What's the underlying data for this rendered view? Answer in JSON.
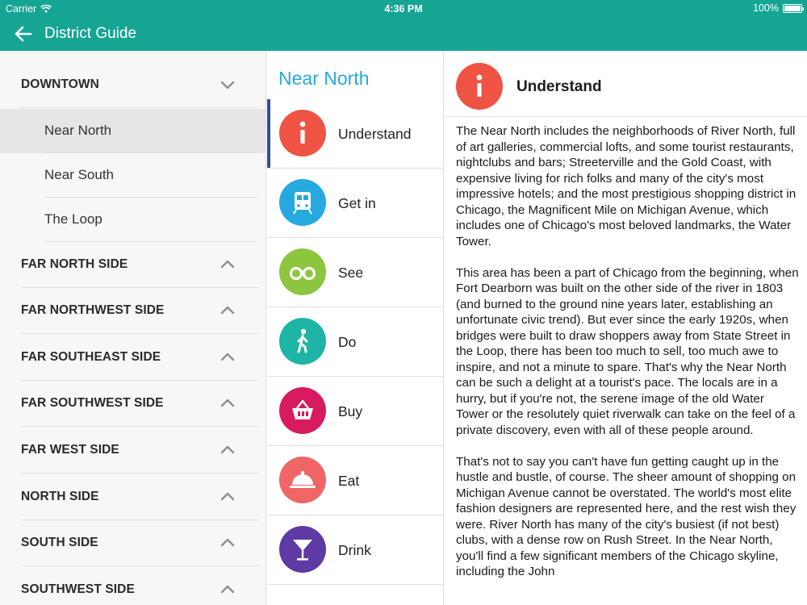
{
  "status_bar": {
    "carrier": "Carrier",
    "time": "4:36 PM",
    "battery": "100%"
  },
  "nav": {
    "title": "District Guide",
    "back_icon": "back-arrow-icon"
  },
  "colors": {
    "header": "#16a593",
    "accent_title": "#25a9e0",
    "selected_bar": "#2f4f98"
  },
  "sidebar": {
    "sections": [
      {
        "label": "DOWNTOWN",
        "expanded": true,
        "items": [
          "Near North",
          "Near South",
          "The Loop"
        ],
        "selected": "Near North"
      },
      {
        "label": "FAR NORTH SIDE",
        "expanded": false
      },
      {
        "label": "FAR NORTHWEST SIDE",
        "expanded": false
      },
      {
        "label": "FAR SOUTHEAST SIDE",
        "expanded": false
      },
      {
        "label": "FAR SOUTHWEST SIDE",
        "expanded": false
      },
      {
        "label": "FAR WEST SIDE",
        "expanded": false
      },
      {
        "label": "NORTH SIDE",
        "expanded": false
      },
      {
        "label": "SOUTH SIDE",
        "expanded": false
      },
      {
        "label": "SOUTHWEST SIDE",
        "expanded": false
      }
    ]
  },
  "district": {
    "title": "Near North",
    "categories": [
      {
        "label": "Understand",
        "icon": "info-icon",
        "color": "#ef5343",
        "selected": true
      },
      {
        "label": "Get in",
        "icon": "train-icon",
        "color": "#25a9e0"
      },
      {
        "label": "See",
        "icon": "binoculars-icon",
        "color": "#8cc63e"
      },
      {
        "label": "Do",
        "icon": "walking-icon",
        "color": "#1eb4a6"
      },
      {
        "label": "Buy",
        "icon": "basket-icon",
        "color": "#d81b60"
      },
      {
        "label": "Eat",
        "icon": "cloche-icon",
        "color": "#f06565"
      },
      {
        "label": "Drink",
        "icon": "cocktail-icon",
        "color": "#5e3aa4"
      }
    ]
  },
  "detail": {
    "title": "Understand",
    "icon": "info-icon",
    "paragraphs": [
      "The Near North includes the neighborhoods of River North, full of art galleries, commercial lofts, and some tourist restaurants, nightclubs and bars; Streeterville and the Gold Coast, with expensive living for rich folks and many of the city's most impressive hotels; and the most prestigious shopping district in Chicago, the Magnificent Mile on Michigan Avenue, which includes one of Chicago's most beloved landmarks, the Water Tower.",
      "This area has been a part of Chicago from the beginning, when Fort Dearborn was built on the other side of the river in 1803 (and burned to the ground nine years later, establishing an unfortunate civic trend). But ever since the early 1920s, when bridges were built to draw shoppers away from State Street in the Loop, there has been too much to sell, too much awe to inspire, and not a minute to spare. That's why the Near North can be such a delight at a tourist's pace. The locals are in a hurry, but if you're not, the serene image of the old Water Tower or the resolutely quiet riverwalk can take on the feel of a private discovery, even with all of these people around.",
      "That's not to say you can't have fun getting caught up in the hustle and bustle, of course. The sheer amount of shopping on Michigan Avenue cannot be overstated. The world's most elite fashion designers are represented here, and the rest wish they were. River North has many of the city's busiest (if not best) clubs, with a dense row on Rush Street. In the Near North, you'll find a few significant members of the Chicago skyline, including the John"
    ]
  }
}
